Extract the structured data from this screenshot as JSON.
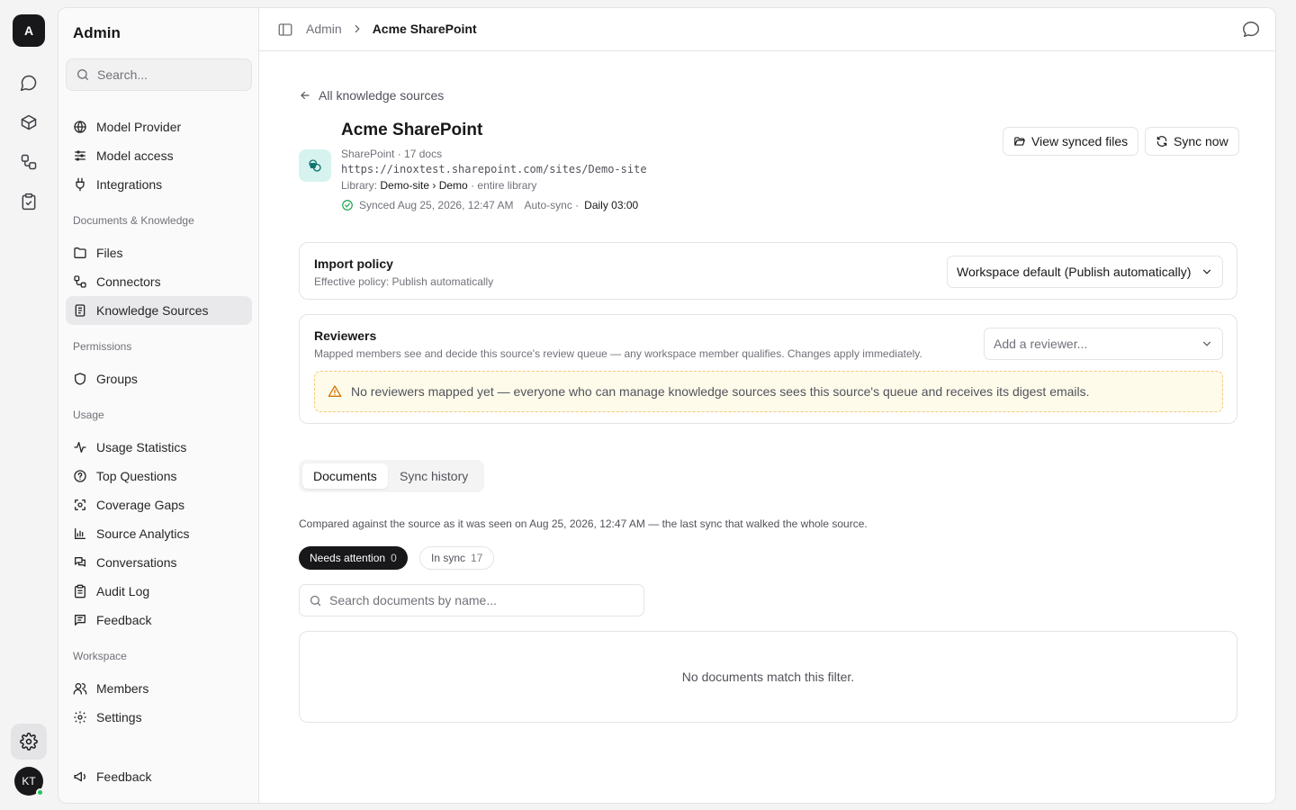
{
  "rail": {
    "logo": "A",
    "icons": [
      "chat-icon",
      "cube-icon",
      "workflow-icon",
      "clipboard-check-icon"
    ],
    "avatar_initials": "KT"
  },
  "sidebar": {
    "title": "Admin",
    "search_placeholder": "Search...",
    "top_items": [
      {
        "label": "Model Provider",
        "icon": "globe-icon"
      },
      {
        "label": "Model access",
        "icon": "sliders-icon"
      },
      {
        "label": "Integrations",
        "icon": "plug-icon"
      }
    ],
    "sections": [
      {
        "title": "Documents & Knowledge",
        "items": [
          {
            "label": "Files",
            "icon": "folder-icon"
          },
          {
            "label": "Connectors",
            "icon": "workflow-icon"
          },
          {
            "label": "Knowledge Sources",
            "icon": "document-icon",
            "active": true
          }
        ]
      },
      {
        "title": "Permissions",
        "items": [
          {
            "label": "Groups",
            "icon": "shield-icon"
          }
        ]
      },
      {
        "title": "Usage",
        "items": [
          {
            "label": "Usage Statistics",
            "icon": "activity-icon"
          },
          {
            "label": "Top Questions",
            "icon": "help-circle-icon"
          },
          {
            "label": "Coverage Gaps",
            "icon": "scan-icon"
          },
          {
            "label": "Source Analytics",
            "icon": "bar-chart-icon"
          },
          {
            "label": "Conversations",
            "icon": "messages-icon"
          },
          {
            "label": "Audit Log",
            "icon": "clipboard-list-icon"
          },
          {
            "label": "Feedback",
            "icon": "message-square-text-icon"
          }
        ]
      },
      {
        "title": "Workspace",
        "items": [
          {
            "label": "Members",
            "icon": "users-icon"
          },
          {
            "label": "Settings",
            "icon": "gear-icon"
          }
        ]
      }
    ],
    "footer_item": {
      "label": "Feedback",
      "icon": "megaphone-icon"
    }
  },
  "header": {
    "breadcrumb_root": "Admin",
    "breadcrumb_current": "Acme SharePoint"
  },
  "source": {
    "back_label": "All knowledge sources",
    "title": "Acme SharePoint",
    "meta": "SharePoint · 17 docs",
    "url": "https://inoxtest.sharepoint.com/sites/Demo-site",
    "library_label": "Library:",
    "library_path": "Demo-site › Demo",
    "library_scope": "· entire library",
    "synced": "Synced Aug 25, 2026, 12:47 AM",
    "auto_sync_label": "Auto-sync ·",
    "auto_sync_value": "Daily 03:00",
    "view_synced_label": "View synced files",
    "sync_now_label": "Sync now"
  },
  "import_policy": {
    "title": "Import policy",
    "subtitle": "Effective policy: Publish automatically",
    "selected": "Workspace default (Publish automatically)"
  },
  "reviewers": {
    "title": "Reviewers",
    "subtitle": "Mapped members see and decide this source's review queue — any workspace member qualifies. Changes apply immediately.",
    "placeholder": "Add a reviewer...",
    "warning": "No reviewers mapped yet — everyone who can manage knowledge sources sees this source's queue and receives its digest emails."
  },
  "tabs": [
    {
      "label": "Documents",
      "active": true
    },
    {
      "label": "Sync history",
      "active": false
    }
  ],
  "documents": {
    "compare_note": "Compared against the source as it was seen on Aug 25, 2026, 12:47 AM — the last sync that walked the whole source.",
    "filters": [
      {
        "label": "Needs attention",
        "count": "0",
        "active": true
      },
      {
        "label": "In sync",
        "count": "17",
        "active": false
      }
    ],
    "search_placeholder": "Search documents by name...",
    "empty_message": "No documents match this filter."
  }
}
